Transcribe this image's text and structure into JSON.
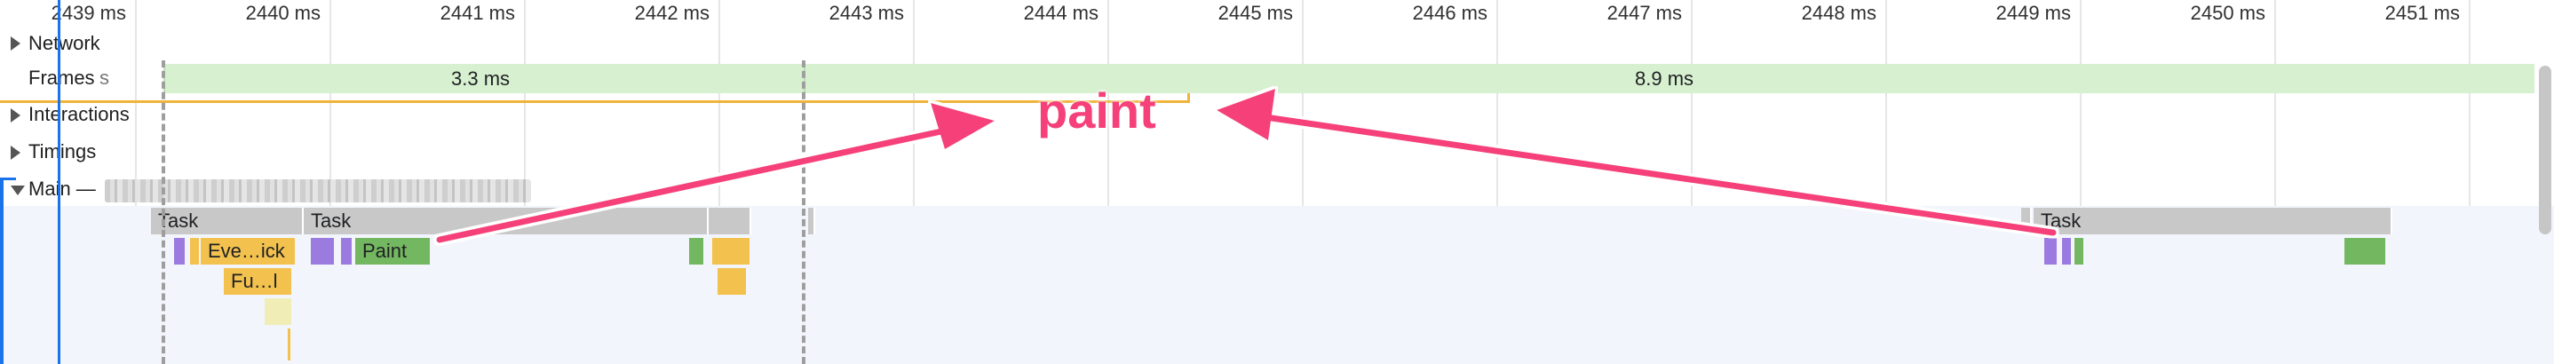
{
  "ruler": {
    "ticks": [
      "2439 ms",
      "2440 ms",
      "2441 ms",
      "2442 ms",
      "2443 ms",
      "2444 ms",
      "2445 ms",
      "2446 ms",
      "2447 ms",
      "2448 ms",
      "2449 ms",
      "2450 ms",
      "2451 ms"
    ]
  },
  "tracks": {
    "network": "Network",
    "frames": "Frames",
    "frames_cut_suffix": "s",
    "interactions": "Interactions",
    "timings": "Timings",
    "main": "Main —"
  },
  "frames": {
    "frame1_duration": "3.3 ms",
    "frame2_duration": "8.9 ms"
  },
  "flame": {
    "task1": "Task",
    "task2": "Task",
    "task3": "Task",
    "event_click": "Eve…ick",
    "function_call": "Fu…l",
    "paint": "Paint"
  },
  "annotation": {
    "text": "paint",
    "color": "#f5407a"
  },
  "colors": {
    "task": "#c8c8c8",
    "scripting": "#f2c14e",
    "rendering": "#9c7be0",
    "painting": "#73b760",
    "frame": "#d7f0d0",
    "selection": "#1a73e8"
  }
}
